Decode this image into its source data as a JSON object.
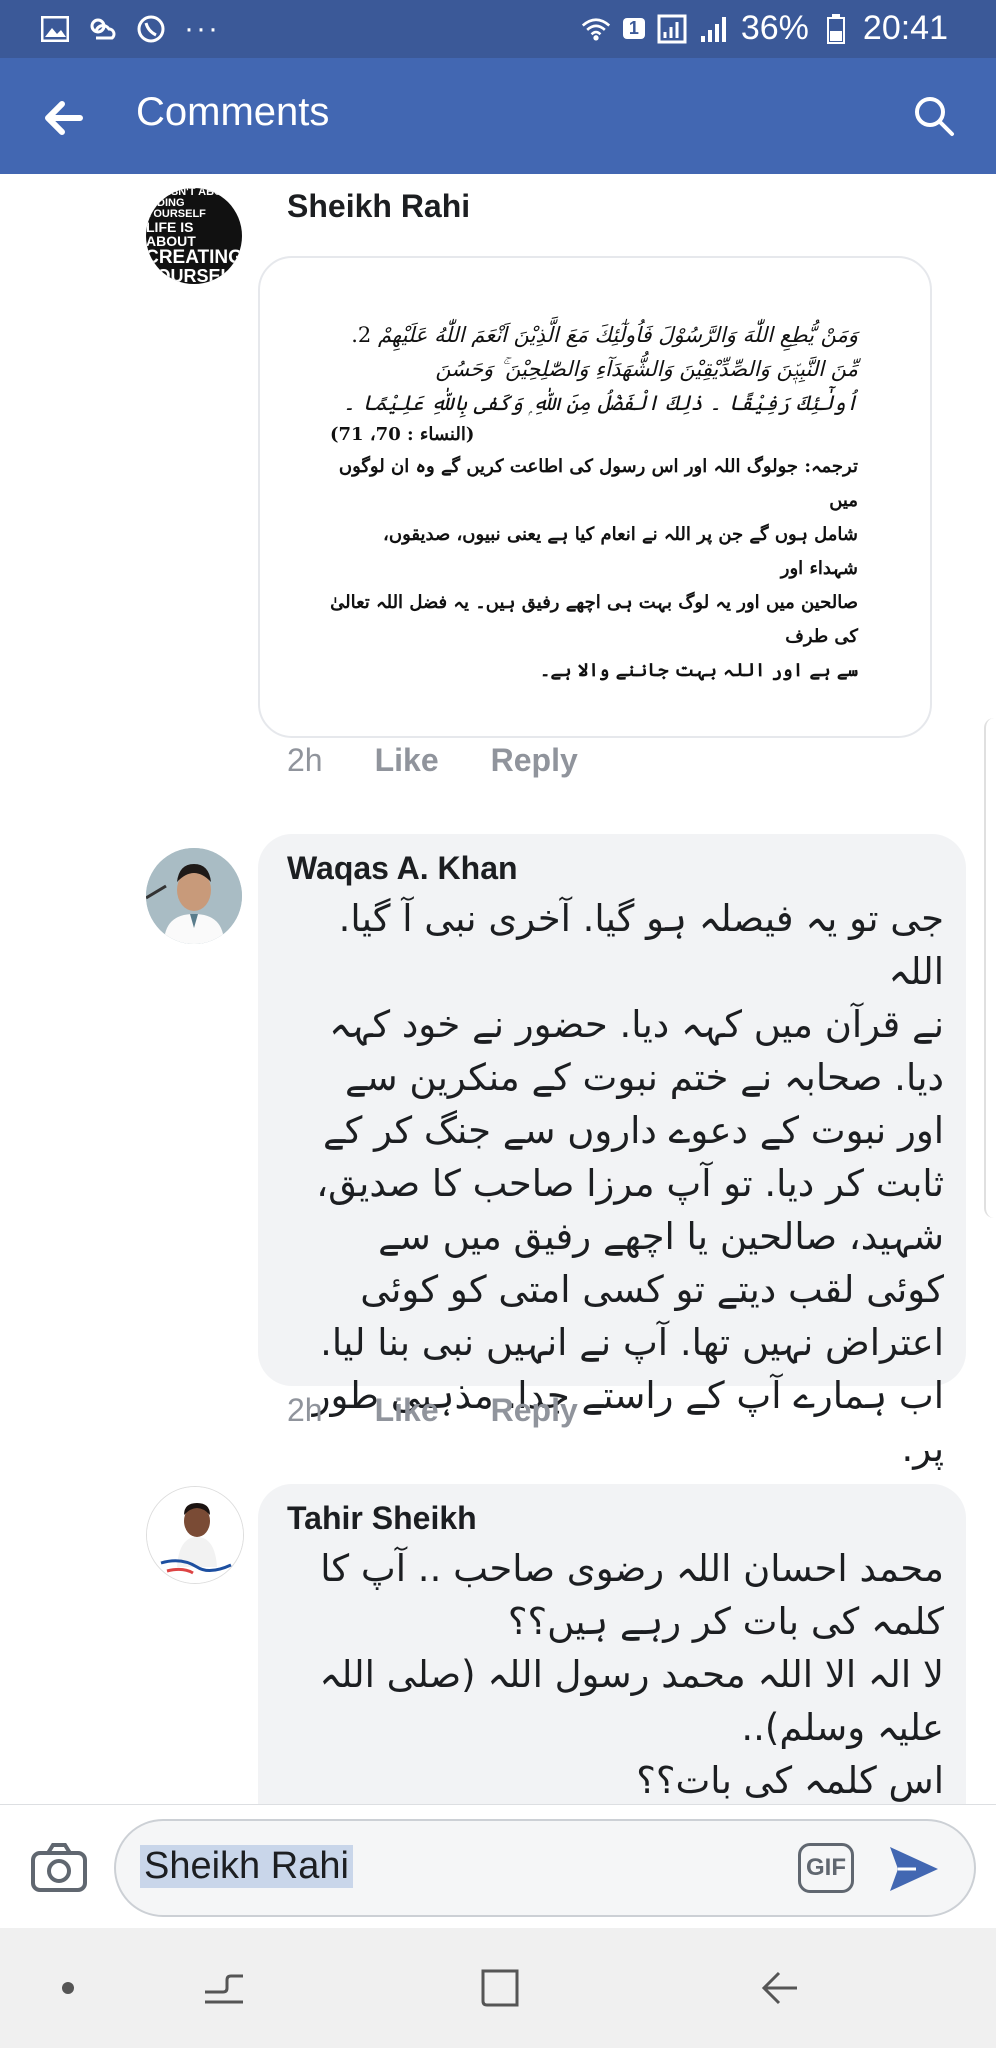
{
  "status_bar": {
    "battery": "36%",
    "time": "20:41",
    "sim": "1",
    "more": "···"
  },
  "header": {
    "title": "Comments"
  },
  "comments": [
    {
      "author": "Sheikh Rahi",
      "avatar_text": [
        "E ISN'T ABOU",
        "INDING YOURSELF",
        "LIFE IS ABOUT",
        "CREATING",
        "OURSEL"
      ],
      "image_lines": {
        "arabic": [
          "وَمَنْ يُّطِعِ اللّٰهَ وَالرَّسُوْلَ فَاُولٰٓئِكَ مَعَ الَّذِيْنَ اَنْعَمَ اللّٰهُ عَلَيْهِمْ",
          "مِّنَ النَّبِيّٖنَ وَالصِّدِّيْقِيْنَ وَالشُّهَدَآءِ وَالصّٰلِحِيْنَ ۚ وَحَسُنَ",
          "اُولٰٓئِكَ رَفِيْقًا ۔ ذٰلِكَ الْفَضْلُ مِنَ اللّٰهِ ۭ وَكَفٰى بِاللّٰهِ عَلِيْمًا ۔"
        ],
        "number": "2.",
        "reference": "(النساء : 70، 71)",
        "urdu": [
          "ترجمہ:   جولوگ اللہ اور اس رسول کی اطاعت کریں گے وہ ان لوگوں میں",
          "شامل ہوں گے جن پر اللہ نے انعام کیا ہے یعنی نبیوں، صدیقوں، شہداء اور",
          "صالحین میں اور یہ لوگ بہت ہی اچھے رفیق ہیں۔ یہ فضل اللہ تعالیٰ کی طرف",
          "سے ہے اور اللہ بہت جاننے والا ہے۔"
        ]
      },
      "time": "2h",
      "like_label": "Like",
      "reply_label": "Reply"
    },
    {
      "author": "Waqas A. Khan",
      "text_lines": [
        "جی تو یہ فیصلہ ہو گیا. آخری نبی آ گیا. اللہ",
        "نے قرآن میں کہہ دیا. حضور نے خود کہہ",
        "دیا. صحابہ نے ختم نبوت کے منکرین سے",
        "اور نبوت کے دعوے داروں سے جنگ کر کے",
        "ثابت کر دیا. تو آپ مرزا صاحب کا صدیق،",
        "شہید، صالحین یا اچھے رفیق میں سے",
        "کوئی لقب دیتے تو کسی امتی کو کوئی",
        "اعتراض نہیں تھا. آپ نے انہیں نبی بنا لیا.",
        "اب ہمارے آپ کے راستے جدا. مذہبی طور پر."
      ],
      "time": "2h",
      "like_label": "Like",
      "reply_label": "Reply"
    },
    {
      "author": "Tahir Sheikh",
      "text_lines": [
        "محمد احسان اللہ رضوی صاحب .. آپ کا",
        "کلمہ کی بات کر رہے ہیں؟؟",
        "لا الہ الا اللہ محمد رسول اللہ (صلی اللہ",
        "علیہ وسلم)..",
        "اس کلمہ کی بات؟؟"
      ]
    }
  ],
  "composer": {
    "value": "Sheikh Rahi",
    "gif_label": "GIF"
  },
  "colors": {
    "status_bar": "#3b5998",
    "app_bar": "#4267b2",
    "send": "#4267b2",
    "bubble": "#f2f3f5"
  }
}
